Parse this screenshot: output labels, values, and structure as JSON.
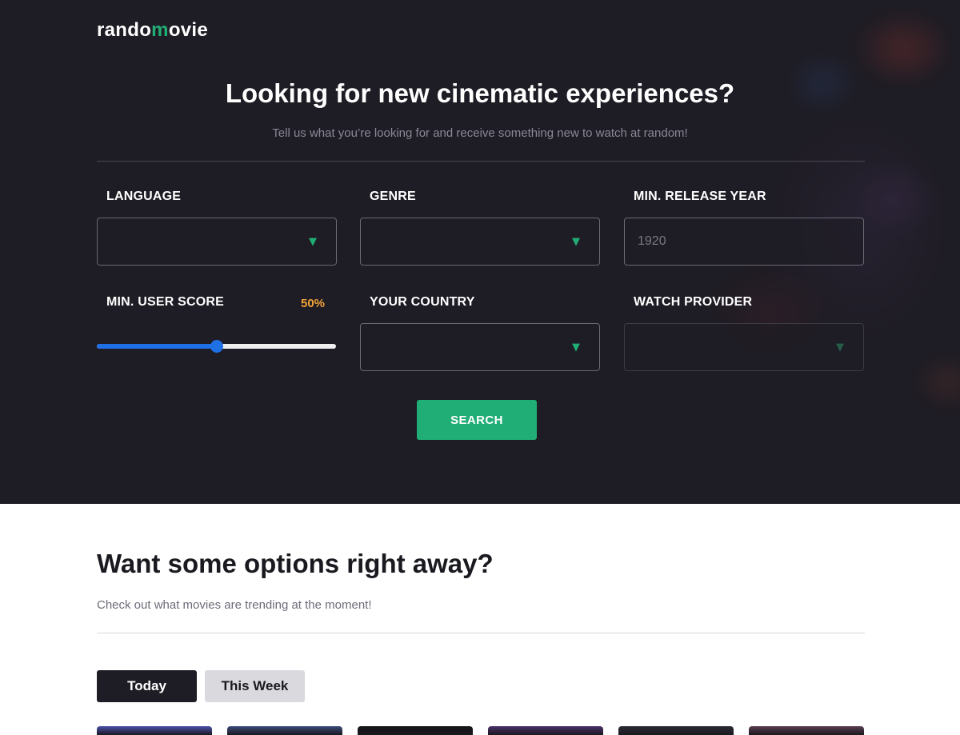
{
  "logo": {
    "prefix": "rando",
    "accent": "m",
    "suffix": "ovie"
  },
  "hero": {
    "title": "Looking for new cinematic experiences?",
    "subtitle": "Tell us what you’re looking for and receive something new to watch at random!"
  },
  "filters": {
    "language": {
      "label": "LANGUAGE",
      "value": ""
    },
    "genre": {
      "label": "GENRE",
      "value": ""
    },
    "min_release_year": {
      "label": "MIN. RELEASE YEAR",
      "placeholder": "1920"
    },
    "min_user_score": {
      "label": "MIN. USER SCORE",
      "value_text": "50%",
      "value": 0.5
    },
    "country": {
      "label": "YOUR COUNTRY",
      "value": ""
    },
    "watch_provider": {
      "label": "WATCH PROVIDER",
      "value": "",
      "disabled": true
    },
    "caret_glyph": "▼"
  },
  "search_button": {
    "label": "SEARCH"
  },
  "trending": {
    "title": "Want some options right away?",
    "subtitle": "Check out what movies are trending at the moment!",
    "tabs": [
      {
        "label": "Today",
        "active": true
      },
      {
        "label": "This Week",
        "active": false
      }
    ],
    "posters": [
      "#4a4fa8",
      "#3b4a7a",
      "#141414",
      "#4b2f6a",
      "#2b2b34",
      "#5a3c50"
    ]
  },
  "colors": {
    "accent_green": "#21ad76",
    "score_orange": "#f2a33a",
    "slider_blue": "#1f6fe5",
    "hero_background": "#1e1c24"
  }
}
